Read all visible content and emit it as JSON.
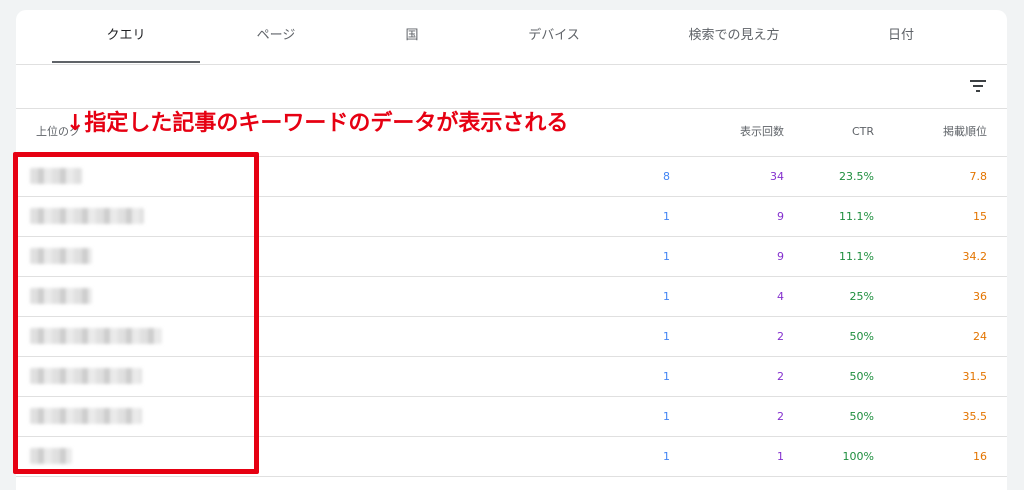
{
  "tabs": [
    {
      "label": "クエリ"
    },
    {
      "label": "ページ"
    },
    {
      "label": "国"
    },
    {
      "label": "デバイス"
    },
    {
      "label": "検索での見え方"
    },
    {
      "label": "日付"
    }
  ],
  "table": {
    "headers": {
      "query": "上位のク",
      "impressions": "表示回数",
      "ctr": "CTR",
      "position": "掲載順位"
    },
    "rows": [
      {
        "clicks": "8",
        "impressions": "34",
        "ctr": "23.5%",
        "position": "7.8"
      },
      {
        "clicks": "1",
        "impressions": "9",
        "ctr": "11.1%",
        "position": "15"
      },
      {
        "clicks": "1",
        "impressions": "9",
        "ctr": "11.1%",
        "position": "34.2"
      },
      {
        "clicks": "1",
        "impressions": "4",
        "ctr": "25%",
        "position": "36"
      },
      {
        "clicks": "1",
        "impressions": "2",
        "ctr": "50%",
        "position": "24"
      },
      {
        "clicks": "1",
        "impressions": "2",
        "ctr": "50%",
        "position": "31.5"
      },
      {
        "clicks": "1",
        "impressions": "2",
        "ctr": "50%",
        "position": "35.5"
      },
      {
        "clicks": "1",
        "impressions": "1",
        "ctr": "100%",
        "position": "16"
      }
    ]
  },
  "annotation": {
    "text": "↓指定した記事のキーワードのデータが表示される"
  },
  "colors": {
    "clicks": "#4285f4",
    "impressions": "#8430ce",
    "ctr": "#1e8e3e",
    "position": "#e37400",
    "annotation": "#e60012"
  },
  "icons": {
    "filter": "filter-list-icon"
  }
}
